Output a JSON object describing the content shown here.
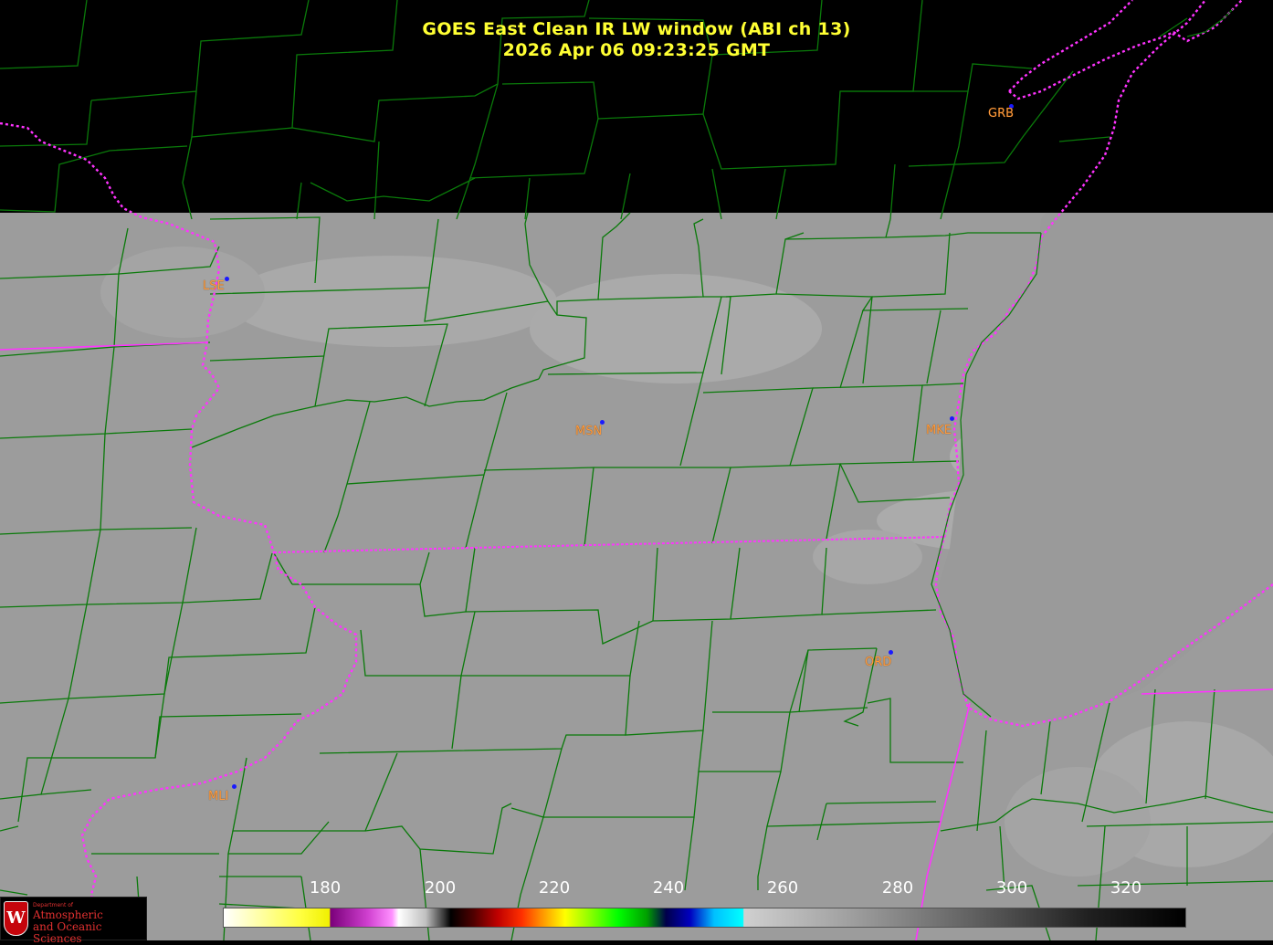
{
  "title": {
    "line1": "GOES East Clean IR LW window (ABI ch 13)",
    "line2": "2026 Apr 06  09:23:25 GMT"
  },
  "stations": [
    {
      "id": "GRB",
      "label": "GRB"
    },
    {
      "id": "LSE",
      "label": "LSE"
    },
    {
      "id": "MSN",
      "label": "MSN"
    },
    {
      "id": "MKE",
      "label": "MKE"
    },
    {
      "id": "ORD",
      "label": "ORD"
    },
    {
      "id": "MLI",
      "label": "MLI"
    }
  ],
  "colorbar": {
    "unit_ticks": [
      "180",
      "200",
      "220",
      "240",
      "260",
      "280",
      "300",
      "320"
    ]
  },
  "logo": {
    "dept_line": "Department of",
    "line1": "Atmospheric",
    "line2": "and Oceanic Sciences",
    "crest_letter": "W"
  },
  "colors": {
    "background": "#000000",
    "title": "#ffff33",
    "county_lines": "#0a7a0a",
    "state_lines": "#ff33ff",
    "station_label": "#ff9a3c",
    "station_dot": "#1a1aff",
    "ir_gray": "#9a9a9a"
  }
}
